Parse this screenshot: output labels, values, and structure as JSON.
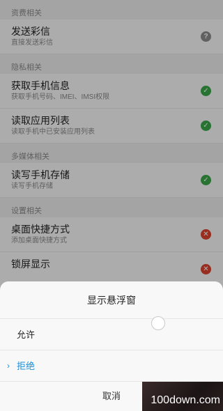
{
  "sections": [
    {
      "header": "资费相关",
      "rows": [
        {
          "title": "发送彩信",
          "sub": "直接发送彩信",
          "status": "help",
          "status_icon": "?"
        }
      ]
    },
    {
      "header": "隐私相关",
      "rows": [
        {
          "title": "获取手机信息",
          "sub": "获取手机号码、IMEI、IMSI权限",
          "status": "ok",
          "status_icon": "✓"
        },
        {
          "title": "读取应用列表",
          "sub": "读取手机中已安装应用列表",
          "status": "ok",
          "status_icon": "✓"
        }
      ]
    },
    {
      "header": "多媒体相关",
      "rows": [
        {
          "title": "读写手机存储",
          "sub": "读写手机存储",
          "status": "ok",
          "status_icon": "✓"
        }
      ]
    },
    {
      "header": "设置相关",
      "rows": [
        {
          "title": "桌面快捷方式",
          "sub": "添加桌面快捷方式",
          "status": "deny",
          "status_icon": "✕"
        },
        {
          "title": "锁屏显示",
          "sub": "",
          "status": "deny",
          "status_icon": "✕"
        }
      ]
    }
  ],
  "dialog": {
    "title": "显示悬浮窗",
    "options": [
      {
        "label": "允许",
        "selected": false
      },
      {
        "label": "拒绝",
        "selected": true,
        "marker": "›"
      }
    ],
    "cancel": "取消"
  },
  "watermark": "100down.com",
  "colors": {
    "ok": "#3aa548",
    "deny": "#d9432f",
    "help": "#8c8c8c",
    "accent": "#1a8fd6"
  }
}
